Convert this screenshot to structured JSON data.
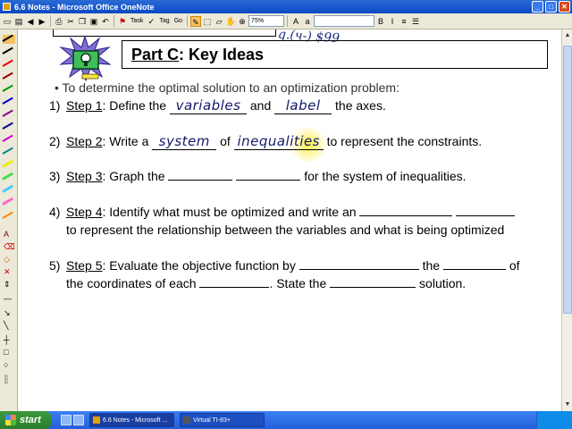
{
  "window": {
    "title": "6.6 Notes - Microsoft Office OneNote"
  },
  "toolbar": {
    "task_label": "Task",
    "tag_label": "Tag",
    "go_label": "Go",
    "zoom": "75%"
  },
  "top_ink": "q.(ч-) $99",
  "header": {
    "prefix": "Part C",
    "rest": ": Key Ideas"
  },
  "bullet": "• To determine the optimal solution to an optimization problem:",
  "steps": [
    {
      "num": "1)",
      "label": "Step 1",
      "text_a": ": Define the ",
      "hw1": "variables",
      "text_b": " and ",
      "hw2": "label",
      "text_c": " the axes."
    },
    {
      "num": "2)",
      "label": "Step 2",
      "text_a": ": Write a ",
      "hw1": "system",
      "text_b": " of ",
      "hw2": "inequalities",
      "text_c": " to represent the constraints."
    },
    {
      "num": "3)",
      "label": "Step 3",
      "text_a": ": Graph the ",
      "text_b": " for the system of inequalities."
    },
    {
      "num": "4)",
      "label": "Step 4",
      "text_a": ": Identify what must be optimized and write an ",
      "line2": "to represent the relationship between the variables and what is being optimized"
    },
    {
      "num": "5)",
      "label": "Step 5",
      "text_a": ": Evaluate the objective function by ",
      "text_b": " the ",
      "text_c": " of",
      "line2_a": "the coordinates of each ",
      "line2_b": ".   State the ",
      "line2_c": " solution."
    }
  ],
  "taskbar": {
    "start_label": "start",
    "tasks": [
      "6.6 Notes - Microsoft ...",
      "Virtual TI-83+"
    ]
  }
}
